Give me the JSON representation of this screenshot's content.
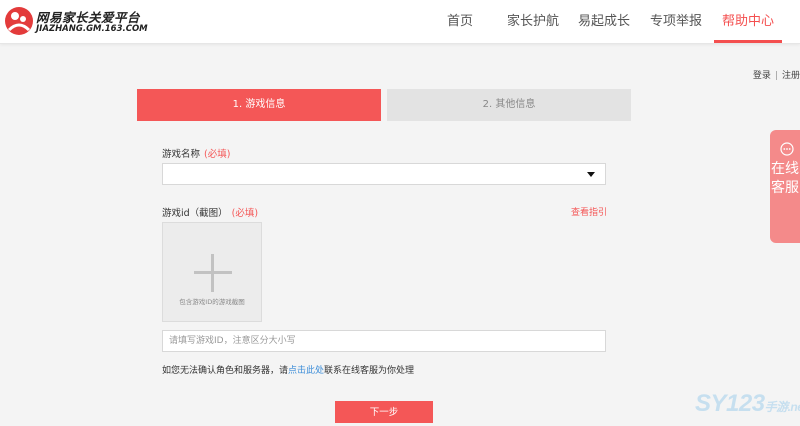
{
  "header": {
    "logo_title": "网易家长关爱平台",
    "logo_url": "JIAZHANG.GM.163.COM",
    "nav": [
      {
        "label": "首页"
      },
      {
        "label": "家长护航"
      },
      {
        "label": "易起成长"
      },
      {
        "label": "专项举报"
      },
      {
        "label": "帮助中心",
        "active": true
      }
    ]
  },
  "auth": {
    "login": "登录",
    "separator": "|",
    "register": "注册"
  },
  "steps": [
    {
      "label": "1. 游戏信息",
      "active": true
    },
    {
      "label": "2. 其他信息",
      "active": false
    }
  ],
  "form": {
    "game_name_label": "游戏名称",
    "required_text": "(必填)",
    "game_select_value": "",
    "game_id_label": "游戏id（截图）",
    "guide_link": "查看指引",
    "upload_caption": "包含游戏ID的游戏截图",
    "id_input_placeholder": "请填写游戏ID，注意区分大小写",
    "hint_prefix": "如您无法确认角色和服务器，请",
    "hint_link": "点击此处",
    "hint_suffix": "联系在线客服为你处理",
    "next_button": "下一步"
  },
  "service_tab": {
    "label": "在线客服",
    "icon": "chat-icon"
  },
  "watermark": {
    "main": "SY123",
    "sub": "手游",
    "suffix": ".net"
  },
  "colors": {
    "accent": "#f45757",
    "tab_bg": "#f48a8a",
    "link": "#3c8dd8"
  }
}
